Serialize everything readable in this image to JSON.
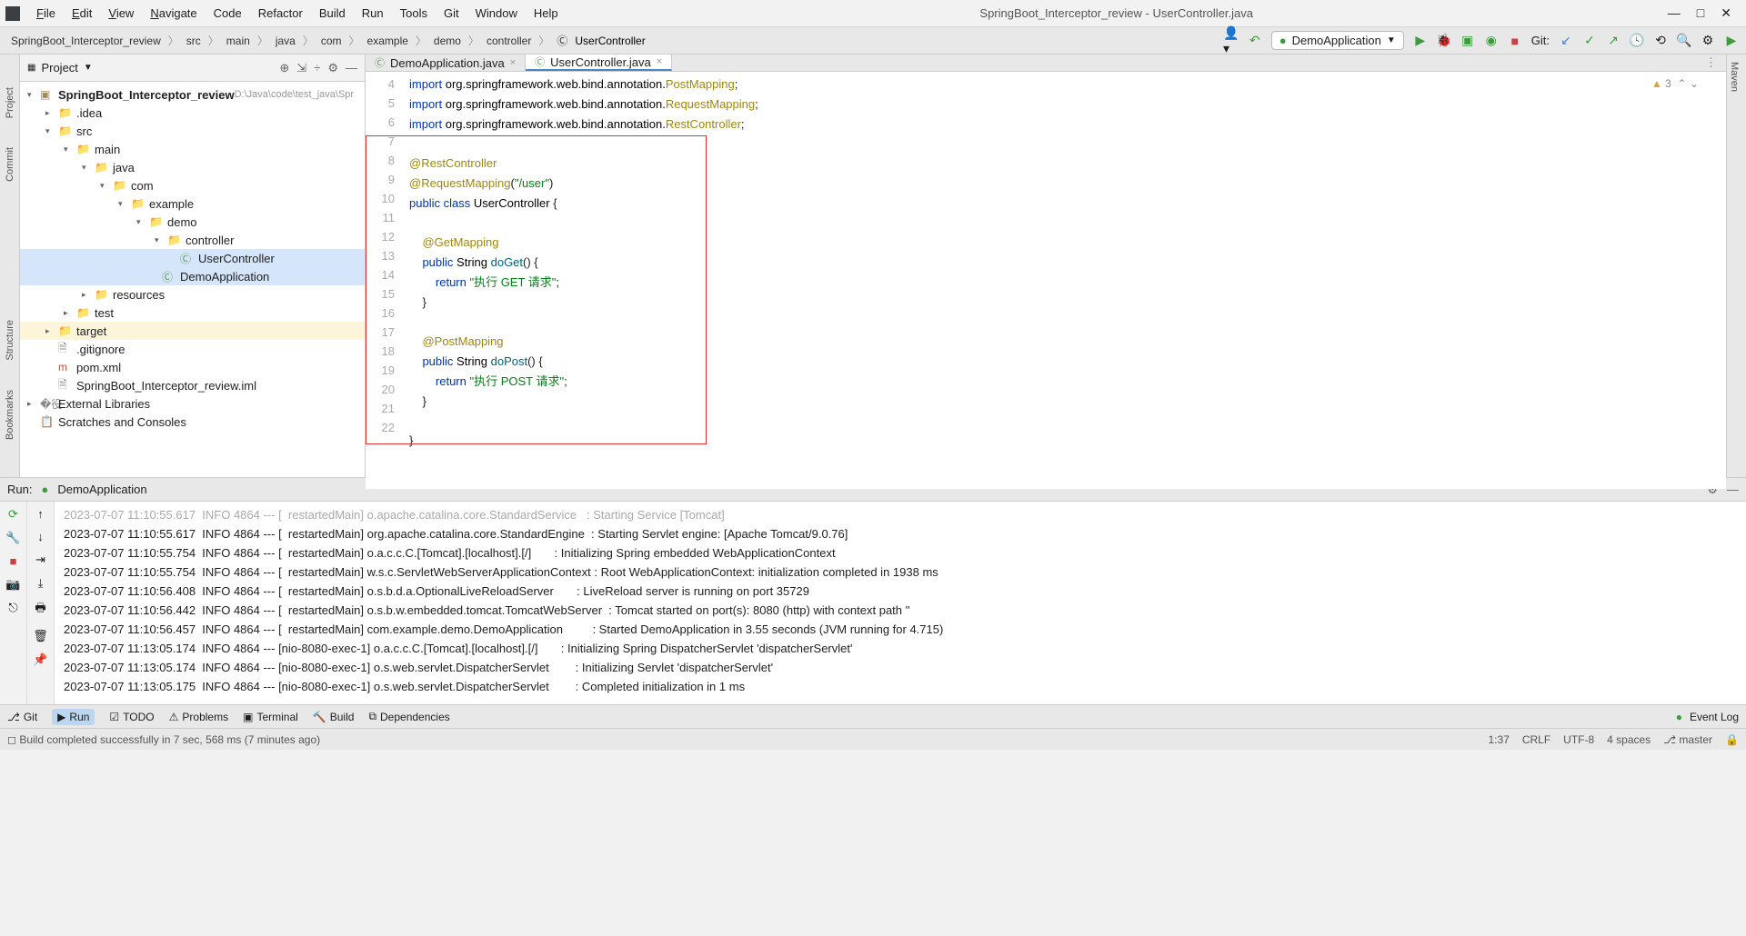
{
  "window": {
    "title": "SpringBoot_Interceptor_review - UserController.java"
  },
  "menu": {
    "file": "File",
    "edit": "Edit",
    "view": "View",
    "navigate": "Navigate",
    "code": "Code",
    "refactor": "Refactor",
    "build": "Build",
    "run": "Run",
    "tools": "Tools",
    "git": "Git",
    "window": "Window",
    "help": "Help"
  },
  "breadcrumbs": {
    "b0": "SpringBoot_Interceptor_review",
    "b1": "src",
    "b2": "main",
    "b3": "java",
    "b4": "com",
    "b5": "example",
    "b6": "demo",
    "b7": "controller",
    "b8": "UserController"
  },
  "runconfig": {
    "name": "DemoApplication"
  },
  "navright": {
    "gitlabel": "Git:"
  },
  "project": {
    "header": "Project",
    "root": "SpringBoot_Interceptor_review",
    "rootpath": " D:\\Java\\code\\test_java\\Spr",
    "idea": ".idea",
    "src": "src",
    "main": "main",
    "java": "java",
    "com": "com",
    "example": "example",
    "demo": "demo",
    "controller": "controller",
    "usercontroller": "UserController",
    "demoapp": "DemoApplication",
    "resources": "resources",
    "test": "test",
    "target": "target",
    "gitignore": ".gitignore",
    "pom": "pom.xml",
    "iml": "SpringBoot_Interceptor_review.iml",
    "extlib": "External Libraries",
    "scratches": "Scratches and Consoles"
  },
  "tabs": {
    "t0": "DemoApplication.java",
    "t1": "UserController.java"
  },
  "problems": {
    "count": "3"
  },
  "gutter": {
    "l4": "4",
    "l5": "5",
    "l6": "6",
    "l7": "7",
    "l8": "8",
    "l9": "9",
    "l10": "10",
    "l11": "11",
    "l12": "12",
    "l13": "13",
    "l14": "14",
    "l15": "15",
    "l16": "16",
    "l17": "17",
    "l18": "18",
    "l19": "19",
    "l20": "20",
    "l21": "21",
    "l22": "22"
  },
  "code": {
    "imp1a": "import ",
    "imp1b": "org.springframework.web.bind.annotation.",
    "imp1c": "PostMapping",
    "imp1d": ";",
    "imp2a": "import ",
    "imp2b": "org.springframework.web.bind.annotation.",
    "imp2c": "RequestMapping",
    "imp2d": ";",
    "imp3a": "import ",
    "imp3b": "org.springframework.web.bind.annotation.",
    "imp3c": "RestController",
    "imp3d": ";",
    "ann1": "@RestController",
    "ann2a": "@RequestMapping",
    "ann2b": "(",
    "ann2c": "\"/user\"",
    "ann2d": ")",
    "clsA": "public class ",
    "clsB": "UserController ",
    "clsC": "{",
    "get1": "    @GetMapping",
    "get2a": "    public ",
    "get2b": "String ",
    "get2c": "doGet",
    "get2d": "() {",
    "get3a": "        return ",
    "get3b": "\"执行 GET 请求\"",
    "get3c": ";",
    "get4": "    }",
    "post1": "    @PostMapping",
    "post2a": "    public ",
    "post2b": "String ",
    "post2c": "doPost",
    "post2d": "() {",
    "post3a": "        return ",
    "post3b": "\"执行 POST 请求\"",
    "post3c": ";",
    "post4": "    }",
    "end": "}"
  },
  "run": {
    "label": "Run:",
    "title": "DemoApplication",
    "line0": "2023-07-07 11:10:55.617  INFO 4864 --- [  restartedMain] o.apache.catalina.core.StandardService   : Starting Service [Tomcat]",
    "line1": "2023-07-07 11:10:55.617  INFO 4864 --- [  restartedMain] org.apache.catalina.core.StandardEngine  : Starting Servlet engine: [Apache Tomcat/9.0.76]",
    "line2": "2023-07-07 11:10:55.754  INFO 4864 --- [  restartedMain] o.a.c.c.C.[Tomcat].[localhost].[/]       : Initializing Spring embedded WebApplicationContext",
    "line3": "2023-07-07 11:10:55.754  INFO 4864 --- [  restartedMain] w.s.c.ServletWebServerApplicationContext : Root WebApplicationContext: initialization completed in 1938 ms",
    "line4": "2023-07-07 11:10:56.408  INFO 4864 --- [  restartedMain] o.s.b.d.a.OptionalLiveReloadServer       : LiveReload server is running on port 35729",
    "line5": "2023-07-07 11:10:56.442  INFO 4864 --- [  restartedMain] o.s.b.w.embedded.tomcat.TomcatWebServer  : Tomcat started on port(s): 8080 (http) with context path ''",
    "line6": "2023-07-07 11:10:56.457  INFO 4864 --- [  restartedMain] com.example.demo.DemoApplication         : Started DemoApplication in 3.55 seconds (JVM running for 4.715)",
    "line7": "2023-07-07 11:13:05.174  INFO 4864 --- [nio-8080-exec-1] o.a.c.c.C.[Tomcat].[localhost].[/]       : Initializing Spring DispatcherServlet 'dispatcherServlet'",
    "line8": "2023-07-07 11:13:05.174  INFO 4864 --- [nio-8080-exec-1] o.s.web.servlet.DispatcherServlet        : Initializing Servlet 'dispatcherServlet'",
    "line9": "2023-07-07 11:13:05.175  INFO 4864 --- [nio-8080-exec-1] o.s.web.servlet.DispatcherServlet        : Completed initialization in 1 ms"
  },
  "bottom": {
    "git": "Git",
    "run": "Run",
    "todo": "TODO",
    "problems": "Problems",
    "terminal": "Terminal",
    "build": "Build",
    "deps": "Dependencies",
    "eventlog": "Event Log"
  },
  "status": {
    "msg": "Build completed successfully in 7 sec, 568 ms (7 minutes ago)",
    "pos": "1:37",
    "lineend": "CRLF",
    "encoding": "UTF-8",
    "indent": "4 spaces",
    "branch": "master"
  },
  "sidebars": {
    "left0": "Project",
    "left1": "Commit",
    "left2": "Structure",
    "left3": "Bookmarks",
    "right0": "Maven"
  }
}
